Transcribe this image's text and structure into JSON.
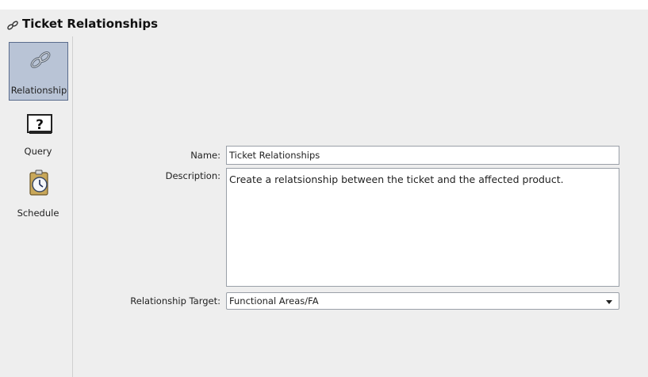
{
  "window": {
    "title": "Ticket Relationships",
    "title_icon": "chain-link-icon"
  },
  "sidebar": {
    "items": [
      {
        "label": "Relationship",
        "icon": "chain-link-icon",
        "selected": true
      },
      {
        "label": "Query",
        "icon": "question-mark-icon",
        "selected": false
      },
      {
        "label": "Schedule",
        "icon": "clock-icon",
        "selected": false
      }
    ]
  },
  "form": {
    "name_label": "Name:",
    "name_value": "Ticket Relationships",
    "description_label": "Description:",
    "description_value": "Create a relatsionship between the ticket and the affected product.",
    "target_label": "Relationship Target:",
    "target_value": "Functional Areas/FA"
  },
  "colors": {
    "selected_bg": "#b9c4d6",
    "selected_border": "#5a6c8c",
    "panel_bg": "#eeeeee"
  }
}
